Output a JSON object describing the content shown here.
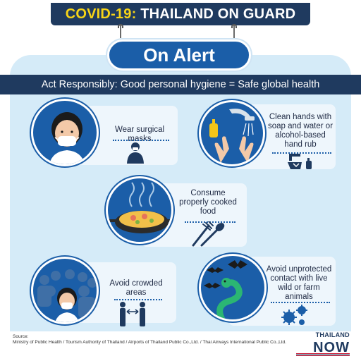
{
  "header": {
    "title_prefix": "COVID-19:",
    "title_suffix": " THAILAND ON GUARD",
    "accent_color": "#f7d417",
    "bg_color": "#1f3a5f"
  },
  "alert": {
    "label": "On Alert",
    "color": "#1b5ea8"
  },
  "banner": {
    "text": "Act Responsibly:  Good personal hygiene = Safe global health"
  },
  "tips": [
    {
      "label": "Wear surgical masks",
      "icon": "mask-person-icon"
    },
    {
      "label": "Clean hands with soap and water or alcohol-based hand rub",
      "icon": "hand-washing-icon"
    },
    {
      "label": "Consume properly cooked food",
      "icon": "cooked-food-icon"
    },
    {
      "label": "Avoid crowded areas",
      "icon": "crowd-icon"
    },
    {
      "label": "Avoid unprotected contact with live wild or farm animals",
      "icon": "animals-icon"
    }
  ],
  "source": {
    "title": "Source:",
    "text": "Ministry of Public Health / Tourism Authority of Thailand  / Airports of Thailand Public Co.,Ltd. / Thai Airways International Public Co.,Ltd."
  },
  "logo": {
    "top": "THAILAND",
    "bottom": "NOW"
  }
}
